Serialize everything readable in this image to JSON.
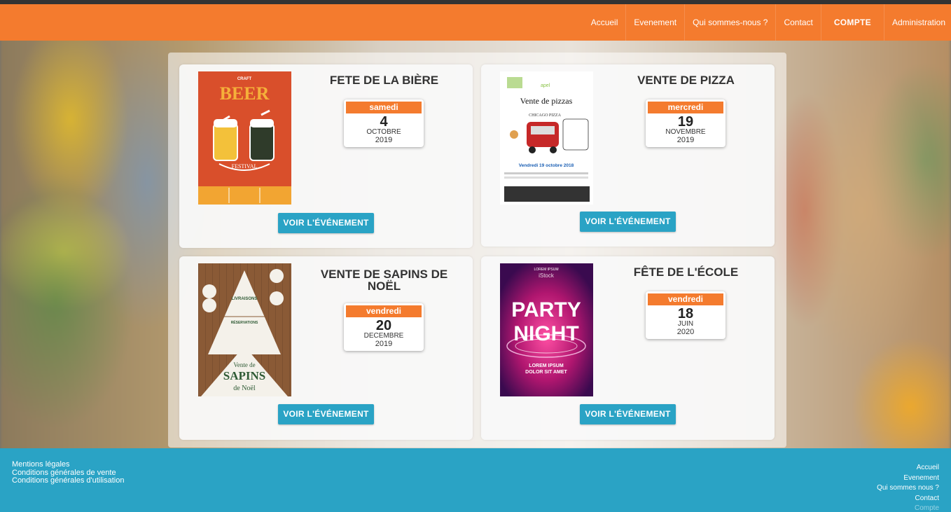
{
  "nav": {
    "items": [
      "Accueil",
      "Evenement",
      "Qui sommes-nous ?",
      "Contact",
      "COMPTE",
      "Administration"
    ]
  },
  "events": [
    {
      "title": "FETE DE LA BIÈRE",
      "weekday": "samedi",
      "day": "4",
      "month": "OCTOBRE",
      "year": "2019",
      "button": "VOIR L'ÉVÉNEMENT",
      "poster": {
        "lines": [
          "CRAFT",
          "BEER",
          "FESTIVAL"
        ]
      }
    },
    {
      "title": "VENTE DE PIZZA",
      "weekday": "mercredi",
      "day": "19",
      "month": "NOVEMBRE",
      "year": "2019",
      "button": "VOIR L'ÉVÉNEMENT",
      "poster": {
        "lines": [
          "apel",
          "Vente de pizzas",
          "CHICAGO PIZZA",
          "Vendredi 19 octobre 2018"
        ]
      }
    },
    {
      "title": "VENTE DE SAPINS DE NOËL",
      "weekday": "vendredi",
      "day": "20",
      "month": "DECEMBRE",
      "year": "2019",
      "button": "VOIR L'ÉVÉNEMENT",
      "poster": {
        "lines": [
          "LIVRAISONS",
          "RÉSERVATIONS",
          "Vente de",
          "SAPINS",
          "de Noël"
        ]
      }
    },
    {
      "title": "FÊTE DE L'ÉCOLE",
      "weekday": "vendredi",
      "day": "18",
      "month": "JUIN",
      "year": "2020",
      "button": "VOIR L'ÉVÉNEMENT",
      "poster": {
        "lines": [
          "LOREM IPSUM",
          "iStock",
          "PARTY",
          "NIGHT",
          "LOREM IPSUM",
          "DOLOR SIT AMET"
        ]
      }
    }
  ],
  "footer": {
    "left": [
      "Mentions légales",
      "Conditions générales de vente",
      "Conditions générales d'utilisation"
    ],
    "right": [
      "Accueil",
      "Evenement",
      "Qui sommes nous ?",
      "Contact",
      "Compte"
    ]
  },
  "colors": {
    "header": "#f47b2e",
    "footer": "#2aa3c5",
    "button": "#2aa3c5",
    "weekday_band": "#f47b2e"
  }
}
